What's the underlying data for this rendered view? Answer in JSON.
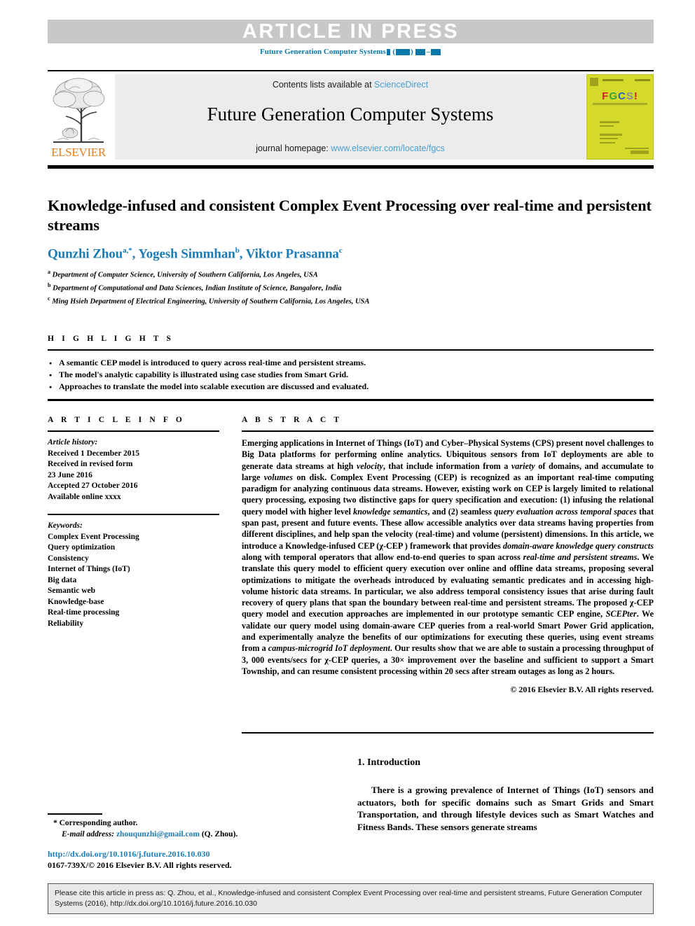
{
  "banner": {
    "label": "ARTICLE IN PRESS",
    "journal_ref_prefix": "Future Generation Computer Systems"
  },
  "masthead": {
    "contents_prefix": "Contents lists available at",
    "contents_link": "ScienceDirect",
    "journal_title": "Future Generation Computer Systems",
    "homepage_prefix": "journal homepage:",
    "homepage_link": "www.elsevier.com/locate/fgcs",
    "publisher": "ELSEVIER",
    "cover": {
      "f": "F",
      "g": "G",
      "c": "C",
      "s": "S",
      "bang": "!"
    }
  },
  "article": {
    "title": "Knowledge-infused and consistent Complex Event Processing over real-time and persistent streams",
    "authors": [
      {
        "name": "Qunzhi Zhou",
        "sup": "a,*"
      },
      {
        "name": "Yogesh Simmhan",
        "sup": "b"
      },
      {
        "name": "Viktor Prasanna",
        "sup": "c"
      }
    ],
    "affiliations": [
      {
        "mark": "a",
        "text": "Department of Computer Science, University of Southern California, Los Angeles, USA"
      },
      {
        "mark": "b",
        "text": "Department of Computational and Data Sciences, Indian Institute of Science, Bangalore, India"
      },
      {
        "mark": "c",
        "text": "Ming Hsieh Department of Electrical Engineering, University of Southern California, Los Angeles, USA"
      }
    ]
  },
  "highlights": {
    "heading": "H I G H L I G H T S",
    "items": [
      "A semantic CEP model is introduced to query across real-time and persistent streams.",
      "The model's analytic capability is illustrated using case studies from Smart Grid.",
      "Approaches to translate the model into scalable execution are discussed and evaluated."
    ]
  },
  "article_info": {
    "heading": "A R T I C L E    I N F O",
    "history_label": "Article history:",
    "history": [
      "Received 1 December 2015",
      "Received in revised form",
      "23 June 2016",
      "Accepted 27 October 2016",
      "Available online xxxx"
    ],
    "keywords_label": "Keywords:",
    "keywords": [
      "Complex Event Processing",
      "Query optimization",
      "Consistency",
      "Internet of Things (IoT)",
      "Big data",
      "Semantic web",
      "Knowledge-base",
      "Real-time processing",
      "Reliability"
    ]
  },
  "abstract": {
    "heading": "A B S T R A C T",
    "paragraph_html": "Emerging applications in Internet of Things (IoT) and Cyber–Physical Systems (CPS) present novel challenges to Big Data platforms for performing online analytics. Ubiquitous sensors from IoT deployments are able to generate data streams at high <i>velocity</i>, that include information from a <i>variety</i> of domains, and accumulate to large <i>volumes</i> on disk. Complex Event Processing (CEP) is recognized as an important real-time computing paradigm for analyzing continuous data streams. However, existing work on CEP is largely limited to relational query processing, exposing two distinctive gaps for query specification and execution: (1) infusing the relational query model with higher level <i>knowledge semantics</i>, and (2) seamless <i>query evaluation across temporal spaces</i> that span past, present and future events. These allow accessible analytics over data streams having properties from different disciplines, and help span the velocity (real-time) and volume (persistent) dimensions. In this article, we introduce a Knowledge-infused CEP (&#967;-CEP ) framework that provides <i>domain-aware knowledge query constructs</i> along with temporal operators that allow end-to-end queries to span across <i>real-time and persistent streams</i>. We translate this query model to efficient query execution over online and offline data streams, proposing several optimizations to mitigate the overheads introduced by evaluating semantic predicates and in accessing high-volume historic data streams. In particular, we also address temporal consistency issues that arise during fault recovery of query plans that span the boundary between real-time and persistent streams. The proposed &#967;-CEP query model and execution approaches are implemented in our prototype semantic CEP engine, <i>SCEPter</i>. We validate our query model using domain-aware CEP queries from a real-world Smart Power Grid application, and experimentally analyze the benefits of our optimizations for executing these queries, using event streams from a <i>campus-microgrid IoT deployment</i>. Our results show that we are able to sustain a processing throughput of 3, 000 events/secs for &#967;-CEP queries, a 30&#215; improvement over the baseline and sufficient to support a Smart Township, and can resume consistent processing within 20 secs after stream outages as long as 2 hours.",
    "copyright": "© 2016 Elsevier B.V. All rights reserved."
  },
  "introduction": {
    "heading": "1.  Introduction",
    "paragraph": "There is a growing prevalence of Internet of Things (IoT) sensors and actuators, both for specific domains such as Smart Grids and Smart Transportation, and through lifestyle devices such as Smart Watches and Fitness Bands. These sensors generate streams"
  },
  "footnote": {
    "corresponding": "*  Corresponding author.",
    "email_label": "E-mail address:",
    "email": "zhouqunzhi@gmail.com",
    "email_suffix": "(Q. Zhou).",
    "doi": "http://dx.doi.org/10.1016/j.future.2016.10.030",
    "issn_line": "0167-739X/© 2016 Elsevier B.V. All rights reserved."
  },
  "cite_box": {
    "text": "Please cite this article in press as: Q. Zhou, et al., Knowledge-infused and consistent Complex Event Processing over real-time and persistent streams, Future Generation Computer Systems (2016), http://dx.doi.org/10.1016/j.future.2016.10.030"
  },
  "colors": {
    "link_blue": "#1b7cb5",
    "light_blue": "#4a9fd4",
    "elsevier_orange": "#e87d1e",
    "banner_gray": "#c8c8c8",
    "cover_yellow": "#d4d92a"
  }
}
